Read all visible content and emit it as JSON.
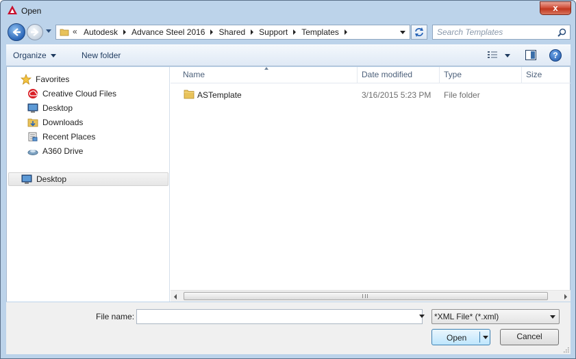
{
  "window": {
    "title": "Open",
    "close_label": "x"
  },
  "address": {
    "overflow": "«",
    "crumbs": [
      "Autodesk",
      "Advance Steel 2016",
      "Shared",
      "Support",
      "Templates"
    ]
  },
  "search": {
    "placeholder": "Search Templates"
  },
  "toolbar": {
    "organize_label": "Organize",
    "new_folder_label": "New folder",
    "help_label": "?"
  },
  "navpane": {
    "favorites_label": "Favorites",
    "items": [
      "Creative Cloud Files",
      "Desktop",
      "Downloads",
      "Recent Places",
      "A360 Drive"
    ],
    "selected_label": "Desktop"
  },
  "files": {
    "columns": [
      "Name",
      "Date modified",
      "Type",
      "Size"
    ],
    "rows": [
      {
        "name": "ASTemplate",
        "date": "3/16/2015 5:23 PM",
        "type": "File folder",
        "size": ""
      }
    ]
  },
  "bottom": {
    "file_name_label": "File name:",
    "file_name_value": "",
    "filter_value": "*XML File* (*.xml)",
    "open_label": "Open",
    "cancel_label": "Cancel"
  },
  "colors": {
    "accent": "#3c7fb1",
    "window_frame": "#bcd3ea",
    "close_red": "#c0371f"
  },
  "icons": [
    "autocad-logo-icon",
    "back-arrow-icon",
    "forward-arrow-icon",
    "folder-icon",
    "refresh-icon",
    "search-icon",
    "view-options-icon",
    "preview-pane-icon",
    "help-icon",
    "star-icon",
    "creative-cloud-icon",
    "desktop-icon",
    "downloads-icon",
    "recent-places-icon",
    "a360-drive-icon"
  ]
}
